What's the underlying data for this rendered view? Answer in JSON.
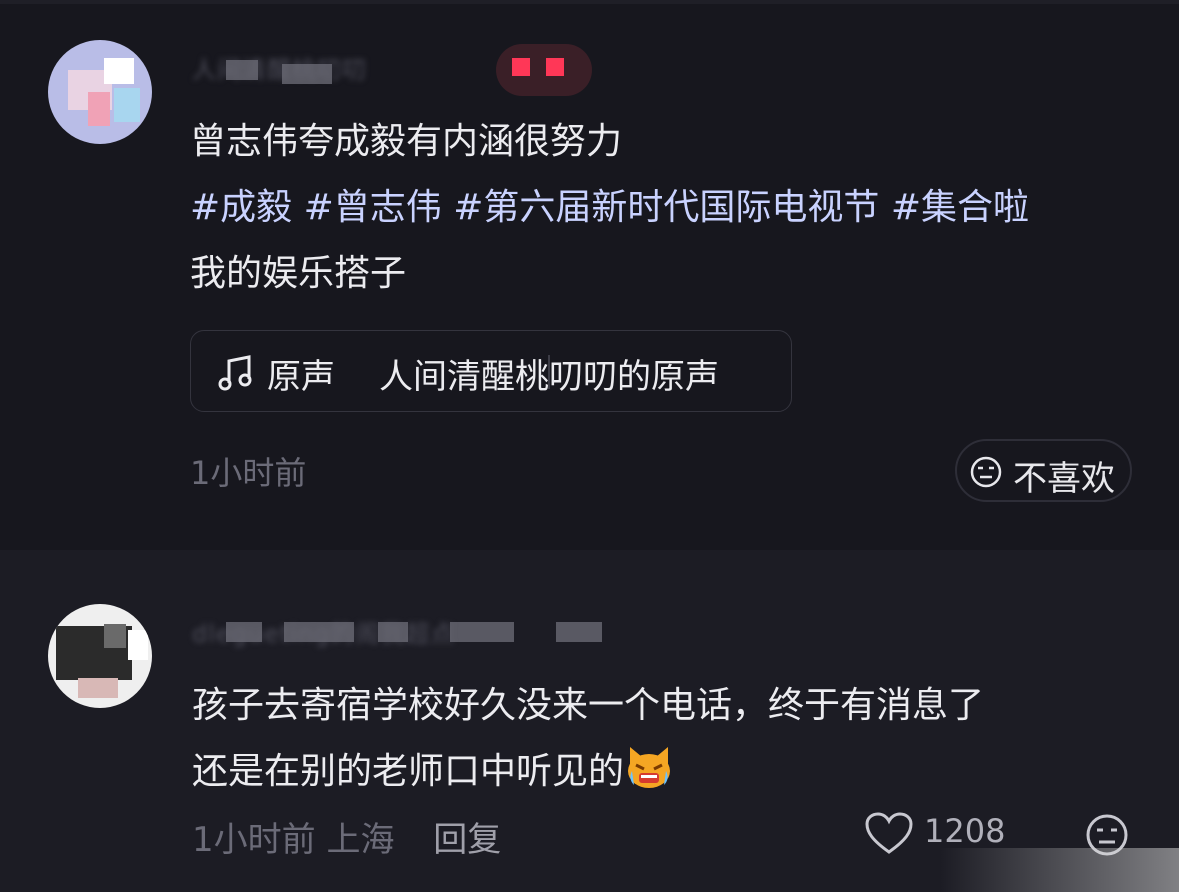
{
  "post": {
    "username_blurred": "人间清醒桃叨叨",
    "caption": "曾志伟夸成毅有内涵很努力",
    "tags_line1": "#成毅 #曾志伟 #第六届新时代国际电视节 #集合啦",
    "tags_line2": "我的娱乐搭子",
    "music_type": "原声",
    "music_title": "人间清醒桃叨叨的原声",
    "time": "1小时前",
    "dislike_label": "不喜欢"
  },
  "comment": {
    "username_blurred": "dlegueting的阁我超点",
    "line1": "孩子去寄宿学校好久没来一个电话，终于有消息了",
    "line2": "还是在别的老师口中听见的",
    "time": "1小时前",
    "location": "上海",
    "reply_label": "回复",
    "like_count": "1208"
  },
  "colors": {
    "tag": "#c9d2ff",
    "muted": "#6b6b78",
    "badge": "#ff3757"
  },
  "icons": [
    "music-note-icon",
    "dislike-face-icon",
    "crying-cat-emoji",
    "heart-icon",
    "smile-face-icon"
  ]
}
